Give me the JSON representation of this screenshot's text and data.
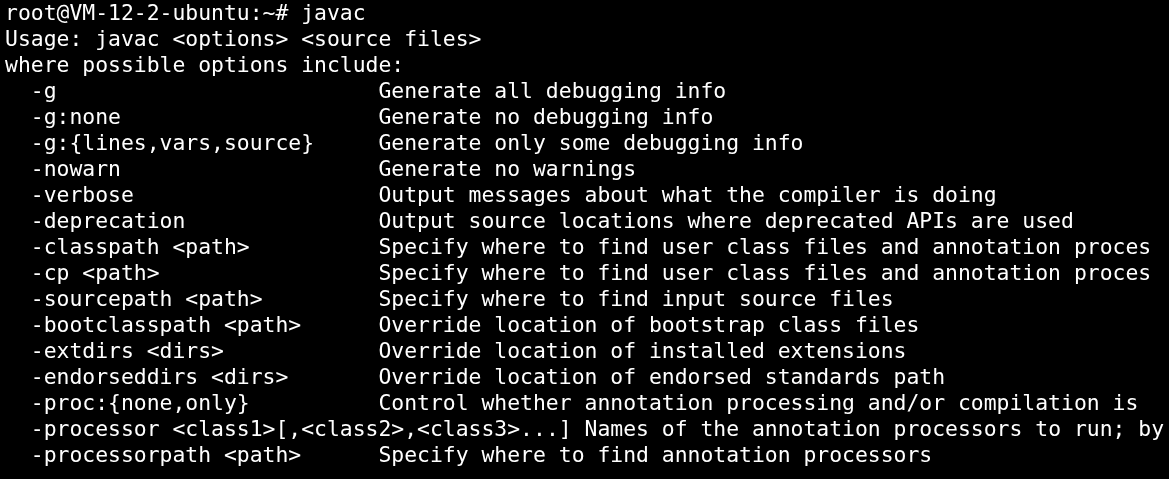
{
  "terminal": {
    "lines": [
      "root@VM-12-2-ubuntu:~# javac",
      "Usage: javac <options> <source files>",
      "where possible options include:"
    ],
    "options": [
      {
        "option": "-g",
        "description": "Generate all debugging info"
      },
      {
        "option": "-g:none",
        "description": "Generate no debugging info"
      },
      {
        "option": "-g:{lines,vars,source}",
        "description": "Generate only some debugging info"
      },
      {
        "option": "-nowarn",
        "description": "Generate no warnings"
      },
      {
        "option": "-verbose",
        "description": "Output messages about what the compiler is doing"
      },
      {
        "option": "-deprecation",
        "description": "Output source locations where deprecated APIs are used"
      },
      {
        "option": "-classpath <path>",
        "description": "Specify where to find user class files and annotation proces"
      },
      {
        "option": "-cp <path>",
        "description": "Specify where to find user class files and annotation proces"
      },
      {
        "option": "-sourcepath <path>",
        "description": "Specify where to find input source files"
      },
      {
        "option": "-bootclasspath <path>",
        "description": "Override location of bootstrap class files"
      },
      {
        "option": "-extdirs <dirs>",
        "description": "Override location of installed extensions"
      },
      {
        "option": "-endorseddirs <dirs>",
        "description": "Override location of endorsed standards path"
      },
      {
        "option": "-proc:{none,only}",
        "description": "Control whether annotation processing and/or compilation is"
      },
      {
        "option": "-processor <class1>[,<class2>,<class3>...]",
        "description": "Names of the annotation processors to run; by"
      },
      {
        "option": "-processorpath <path>",
        "description": "Specify where to find annotation processors"
      }
    ]
  }
}
